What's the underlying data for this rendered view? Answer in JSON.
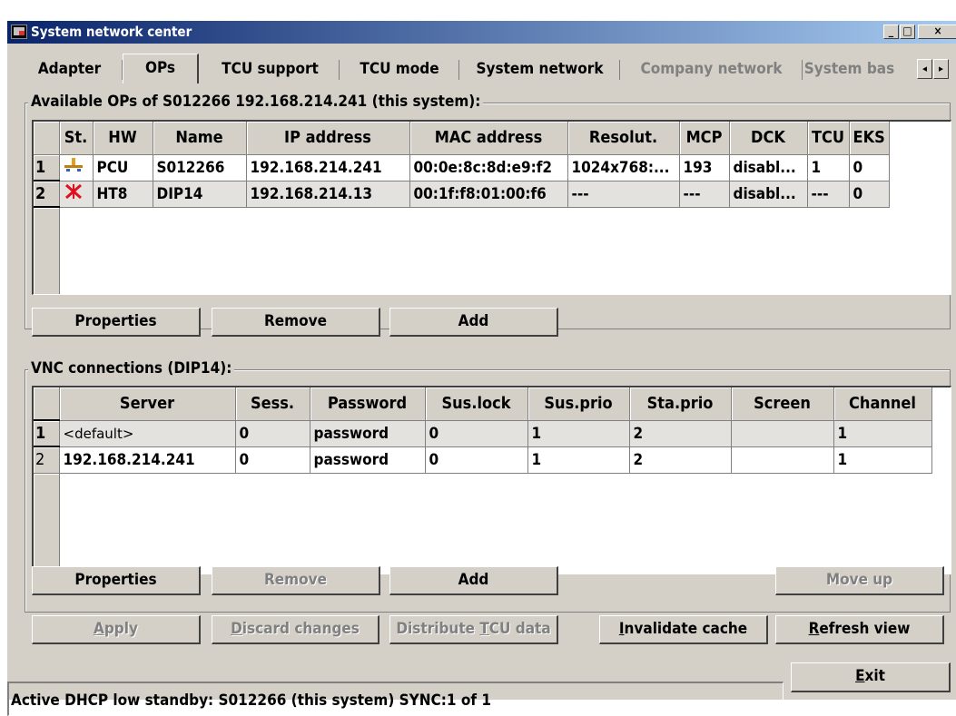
{
  "window": {
    "title": "System network center"
  },
  "titlebar_buttons": {
    "minimize": "_",
    "maximize": "□",
    "close": "×"
  },
  "tabs": [
    {
      "label": "Adapter"
    },
    {
      "label": "OPs"
    },
    {
      "label": "TCU support"
    },
    {
      "label": "TCU mode"
    },
    {
      "label": "System network"
    },
    {
      "label": "Company network"
    },
    {
      "label": "System bas"
    }
  ],
  "tab_scroll": {
    "left": "◂",
    "right": "▸"
  },
  "ops_group": {
    "label": "Available OPs of S012266 192.168.214.241 (this system):",
    "columns": [
      "",
      "St.",
      "HW",
      "Name",
      "IP address",
      "MAC address",
      "Resolut.",
      "MCP",
      "DCK",
      "TCU",
      "EKS"
    ],
    "rows": [
      {
        "num": "1",
        "status_icon": "network-icon",
        "hw": "PCU",
        "name": "S012266",
        "ip": "192.168.214.241",
        "mac": "00:0e:8c:8d:e9:f2",
        "resolution": "1024x768:...",
        "mcp": "193",
        "dck": "disabl...",
        "tcu": "1",
        "eks": "0"
      },
      {
        "num": "2",
        "status_icon": "error-x-icon",
        "hw": "HT8",
        "name": "DIP14",
        "ip": "192.168.214.13",
        "mac": "00:1f:f8:01:00:f6",
        "resolution": "---",
        "mcp": "---",
        "dck": "disabl...",
        "tcu": "---",
        "eks": "0"
      }
    ],
    "buttons": {
      "properties": "Properties",
      "remove": "Remove",
      "add": "Add"
    }
  },
  "vnc_group": {
    "label": "VNC connections (DIP14):",
    "columns": [
      "",
      "Server",
      "Sess.",
      "Password",
      "Sus.lock",
      "Sus.prio",
      "Sta.prio",
      "Screen",
      "Channel"
    ],
    "rows": [
      {
        "num": "1",
        "server": "<default>",
        "sess": "0",
        "password": "password",
        "sus_lock": "0",
        "sus_prio": "1",
        "sta_prio": "2",
        "screen": "",
        "channel": "1"
      },
      {
        "num": "2",
        "server": "192.168.214.241",
        "sess": "0",
        "password": "password",
        "sus_lock": "0",
        "sus_prio": "1",
        "sta_prio": "2",
        "screen": "",
        "channel": "1"
      }
    ],
    "buttons": {
      "properties": "Properties",
      "remove": "Remove",
      "add": "Add",
      "move_up": "Move up"
    }
  },
  "bottom_buttons": {
    "apply": {
      "mnemonic": "A",
      "rest": "pply"
    },
    "discard": {
      "mnemonic": "D",
      "rest": "iscard changes"
    },
    "distribute": {
      "pre": "Distribute ",
      "mnemonic": "T",
      "post": "CU data"
    },
    "invalidate": {
      "mnemonic": "I",
      "rest": "nvalidate cache"
    },
    "refresh": {
      "mnemonic": "R",
      "rest": "efresh view"
    }
  },
  "status": {
    "text": "Active DHCP low standby: S012266 (this system) SYNC:1 of 1"
  },
  "exit": {
    "mnemonic": "E",
    "rest": "xit"
  }
}
